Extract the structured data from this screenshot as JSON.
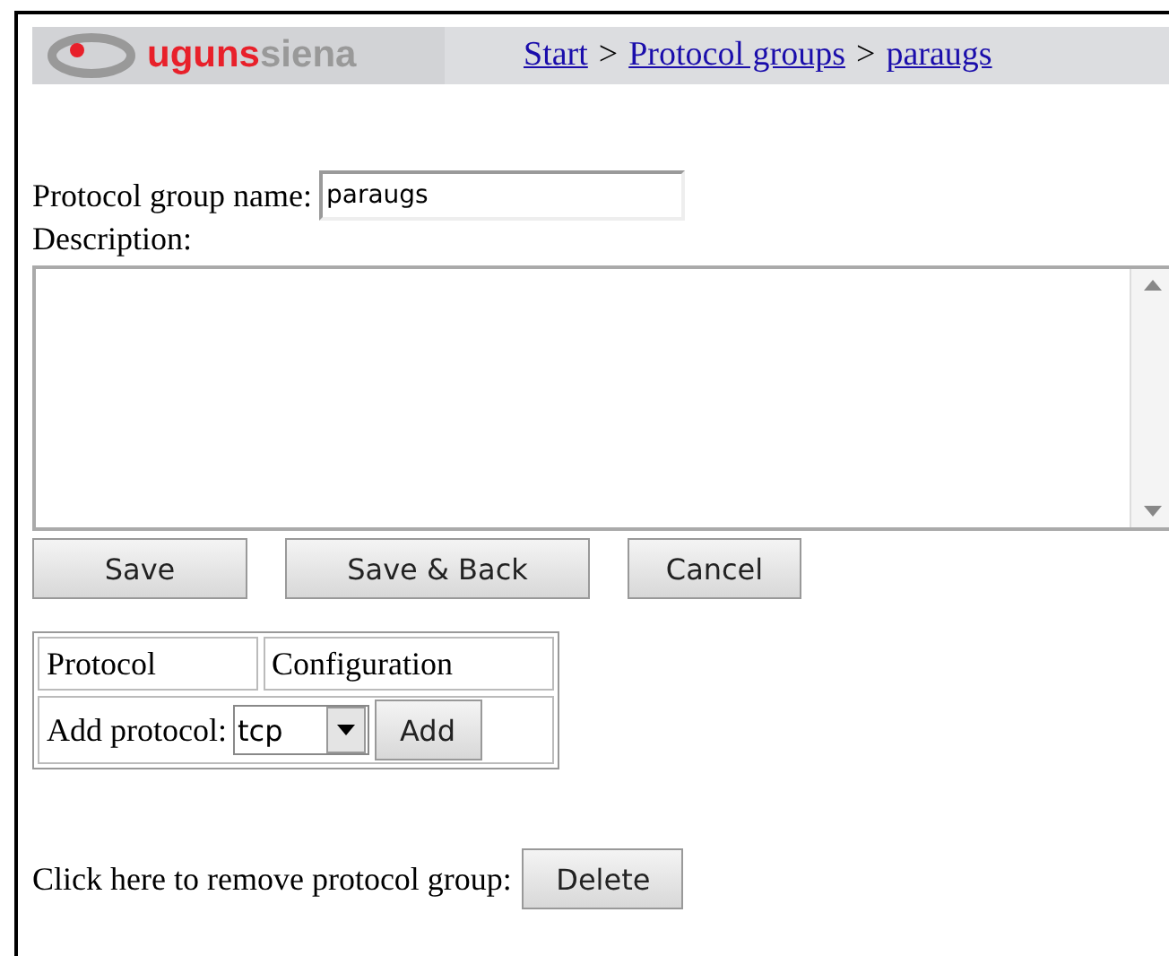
{
  "header": {
    "logo": {
      "part_1": "uguns",
      "part_2": "siena"
    },
    "breadcrumb": [
      {
        "label": "Start"
      },
      {
        "label": "Protocol groups"
      },
      {
        "label": "paraugs"
      }
    ],
    "separator": ">"
  },
  "form": {
    "name_label": "Protocol group name:",
    "name_value": "paraugs",
    "description_label": "Description:",
    "buttons": [
      "Save",
      "Save & Back",
      "Cancel"
    ]
  },
  "protocol_table": {
    "columns": [
      "Protocol",
      "Configuration"
    ],
    "add_label": "Add protocol:",
    "select_value": "tcp",
    "add_button": "Add"
  },
  "delete": {
    "text": "Click here to remove protocol group:",
    "button": "Delete"
  }
}
